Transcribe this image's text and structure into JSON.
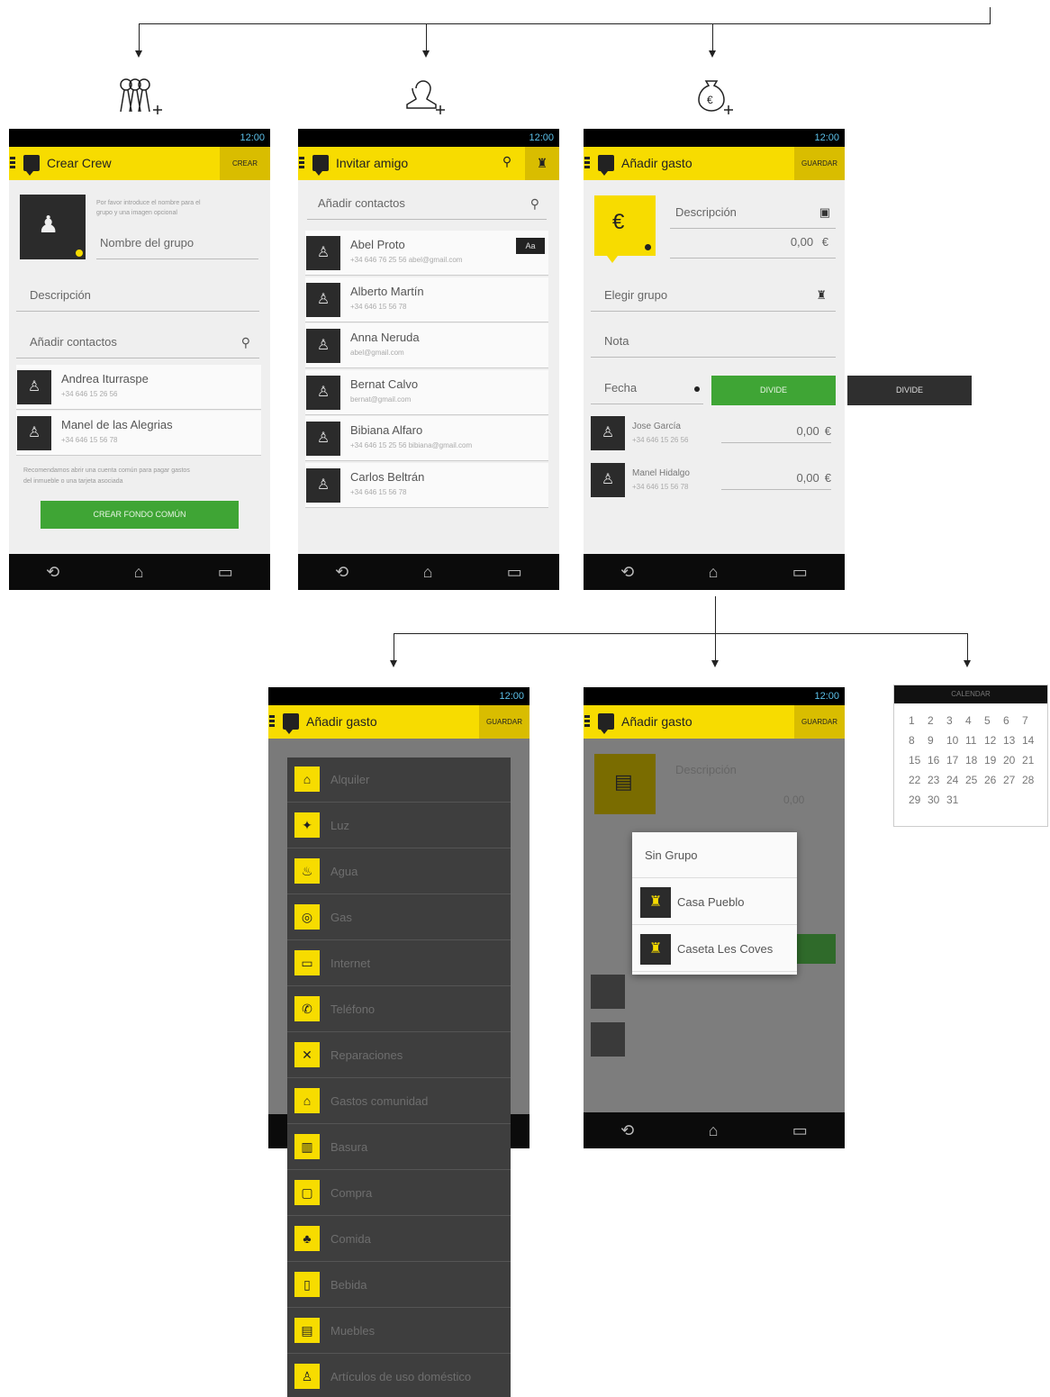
{
  "screen1": {
    "status_time": "12:00",
    "title": "Crear Crew",
    "action": "CREAR",
    "helper_text_line1": "Por favor introduce el nombre para el",
    "helper_text_line2": "grupo y una imagen opcional",
    "group_name_placeholder": "Nombre del grupo",
    "description_placeholder": "Descripción",
    "add_contacts_placeholder": "Añadir contactos",
    "contacts": [
      {
        "name": "Andrea Iturraspe",
        "phone": "+34 646 15 26 56"
      },
      {
        "name": "Manel de las Alegrias",
        "phone": "+34 646 15 56 78"
      }
    ],
    "note_line1": "Recomendamos abrir una cuenta común para pagar gastos",
    "note_line2": "del inmueble o una tarjeta asociada",
    "fund_button": "CREAR FONDO COMÚN"
  },
  "screen2": {
    "status_time": "12:00",
    "title": "Invitar amigo",
    "add_contacts_placeholder": "Añadir contactos",
    "az_badge": "Aa",
    "contacts": [
      {
        "name": "Abel Proto",
        "sub": "+34 646 76 25 56   abel@gmail.com"
      },
      {
        "name": "Alberto Martín",
        "sub": "+34 646 15 56 78"
      },
      {
        "name": "Anna Neruda",
        "sub": "abel@gmail.com"
      },
      {
        "name": "Bernat Calvo",
        "sub": "bernat@gmail.com"
      },
      {
        "name": "Bibiana Alfaro",
        "sub": "+34 646 15 25 56   bibiana@gmail.com"
      },
      {
        "name": "Carlos Beltrán",
        "sub": "+34 646 15 56 78"
      }
    ]
  },
  "screen3": {
    "status_time": "12:00",
    "title": "Añadir gasto",
    "action": "GUARDAR",
    "description_placeholder": "Descripción",
    "amount": "0,00",
    "currency": "€",
    "group_placeholder": "Elegir grupo",
    "note_placeholder": "Nota",
    "date_placeholder": "Fecha",
    "divide_label": "DIVIDE",
    "people": [
      {
        "name": "Jose García",
        "sub": "+34 646 15 26 56",
        "amount": "0,00",
        "currency": "€"
      },
      {
        "name": "Manel Hidalgo",
        "sub": "+34 646 15 56 78",
        "amount": "0,00",
        "currency": "€"
      }
    ]
  },
  "divide_variant_label": "DIVIDE",
  "screen4": {
    "status_time": "12:00",
    "title": "Añadir gasto",
    "action": "GUARDAR",
    "categories": [
      {
        "label": "Alquiler",
        "icon": "house-icon"
      },
      {
        "label": "Luz",
        "icon": "bulb-icon"
      },
      {
        "label": "Agua",
        "icon": "tap-icon"
      },
      {
        "label": "Gas",
        "icon": "gas-icon"
      },
      {
        "label": "Internet",
        "icon": "laptop-icon"
      },
      {
        "label": "Teléfono",
        "icon": "phone-icon"
      },
      {
        "label": "Reparaciones",
        "icon": "tools-icon"
      },
      {
        "label": "Gastos comunidad",
        "icon": "community-icon"
      },
      {
        "label": "Basura",
        "icon": "trash-icon"
      },
      {
        "label": "Compra",
        "icon": "bag-icon"
      },
      {
        "label": "Comida",
        "icon": "food-icon"
      },
      {
        "label": "Bebida",
        "icon": "drink-icon"
      },
      {
        "label": "Muebles",
        "icon": "furniture-icon"
      },
      {
        "label": "Artículos de uso doméstico",
        "icon": "household-icon"
      }
    ]
  },
  "screen5": {
    "status_time": "12:00",
    "title": "Añadir gasto",
    "action": "GUARDAR",
    "description_placeholder": "Descripción",
    "amount": "0,00",
    "dialog_options": [
      {
        "label": "Sin Grupo"
      },
      {
        "label": "Casa Pueblo"
      },
      {
        "label": "Caseta Les Coves"
      }
    ]
  },
  "calendar": {
    "header": "CALENDAR",
    "days": [
      "1",
      "2",
      "3",
      "4",
      "5",
      "6",
      "7",
      "8",
      "9",
      "10",
      "11",
      "12",
      "13",
      "14",
      "15",
      "16",
      "17",
      "18",
      "19",
      "20",
      "21",
      "22",
      "23",
      "24",
      "25",
      "26",
      "27",
      "28",
      "29",
      "30",
      "31"
    ]
  }
}
